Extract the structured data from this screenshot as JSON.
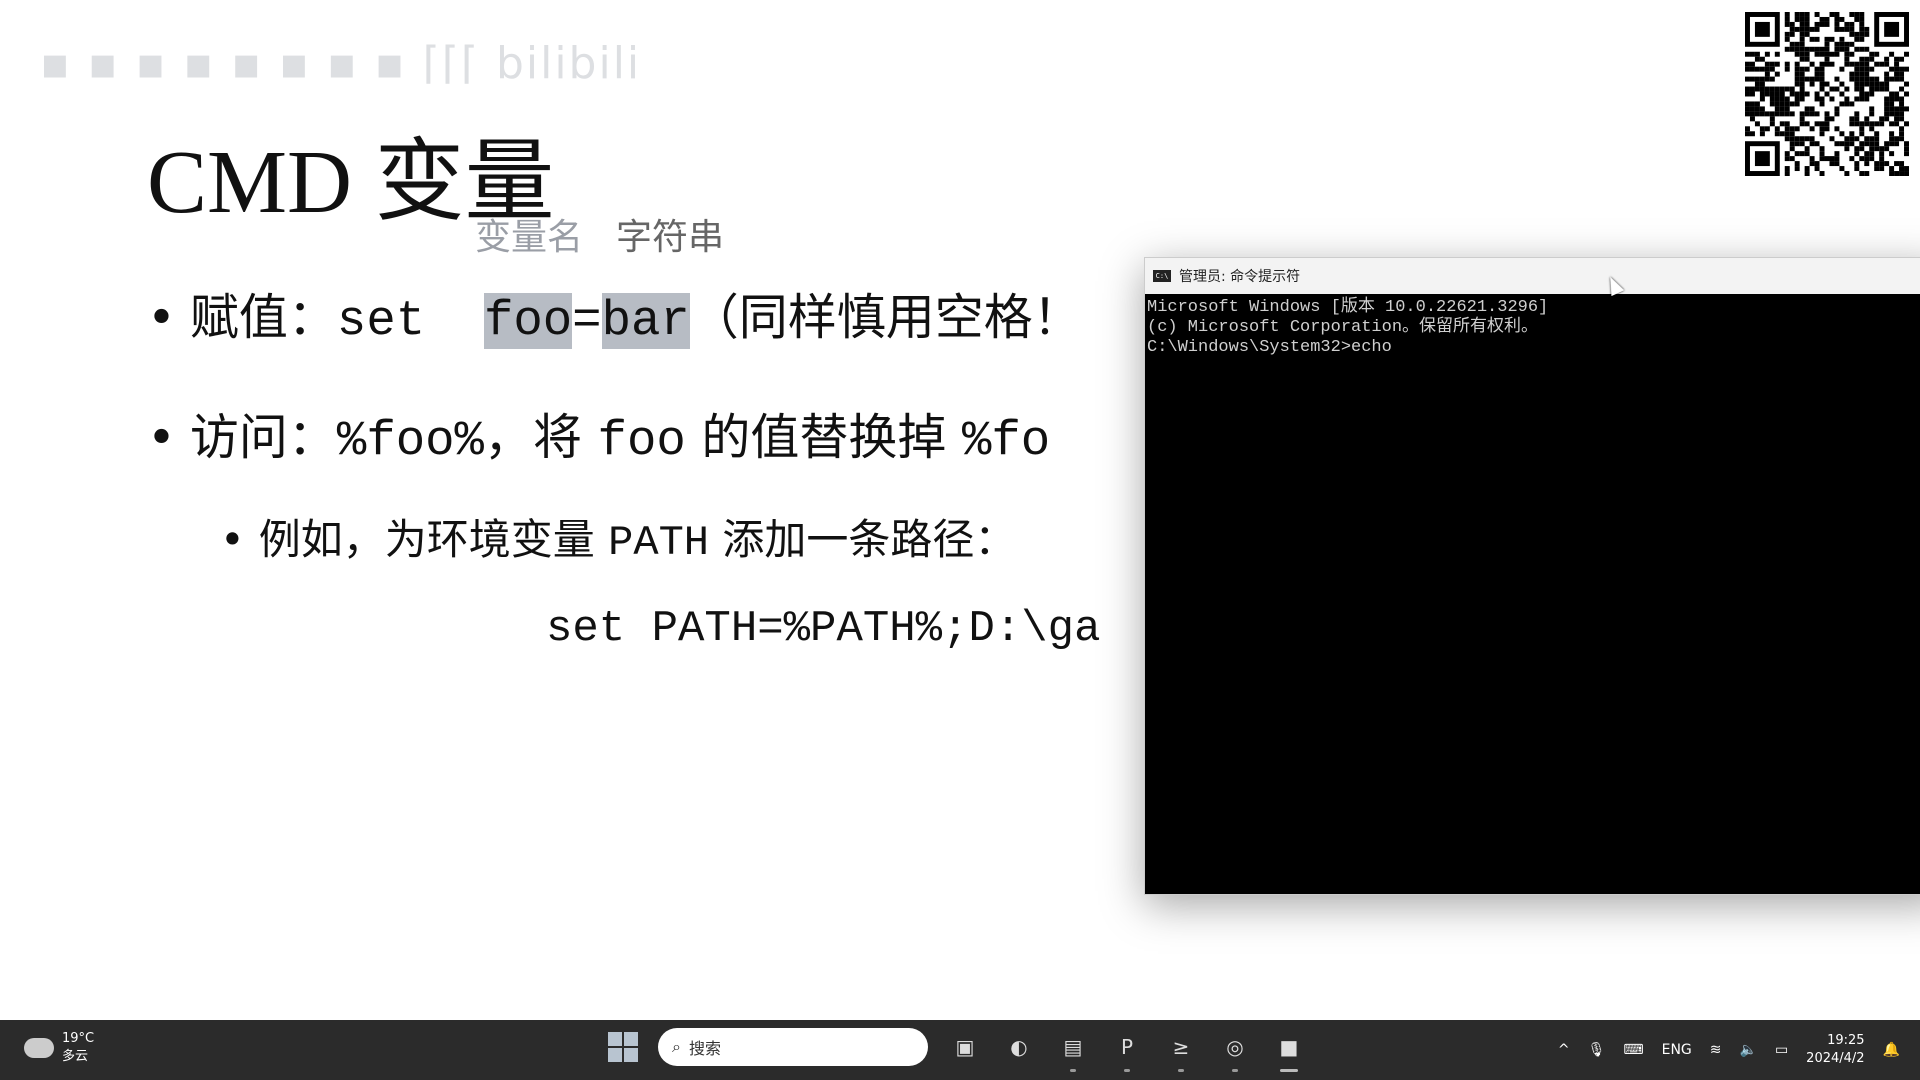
{
  "watermark": "bilibili",
  "slide": {
    "title": "CMD 变量",
    "annotation_name": "变量名",
    "annotation_string": "字符串",
    "bullet1": {
      "label": "赋值：",
      "cmd": "set",
      "var": "foo",
      "eq": "=",
      "val": "bar",
      "note": "（同样慎用空格！"
    },
    "bullet2": {
      "label": "访问：",
      "a": "%foo%",
      "b": "，将",
      "c": "foo",
      "d": "的值替换掉",
      "e": "%fo"
    },
    "sub_bullet": {
      "a": "例如，为环境变量",
      "b": "PATH",
      "c": "添加一条路径："
    },
    "code": "set PATH=%PATH%;D:\\ga"
  },
  "cmd_window": {
    "title": "管理员: 命令提示符",
    "icon": "cmd-icon",
    "lines": [
      "Microsoft Windows [版本 10.0.22621.3296]",
      "(c) Microsoft Corporation。保留所有权利。",
      "",
      "C:\\Windows\\System32>echo"
    ]
  },
  "taskbar": {
    "weather_temp": "19°C",
    "weather_desc": "多云",
    "search_placeholder": "搜索",
    "apps": [
      "task-view-icon",
      "edge-icon",
      "file-explorer-icon",
      "powerpoint-icon",
      "terminal-icon",
      "obs-icon",
      "cmd-icon"
    ],
    "tray": {
      "lang": "ENG",
      "time": "19:25",
      "date": "2024/4/2"
    }
  },
  "colors": {
    "highlight": "#b7bcc4",
    "taskbar": "#2b2b2b",
    "annotation": "#9a9ea6"
  }
}
